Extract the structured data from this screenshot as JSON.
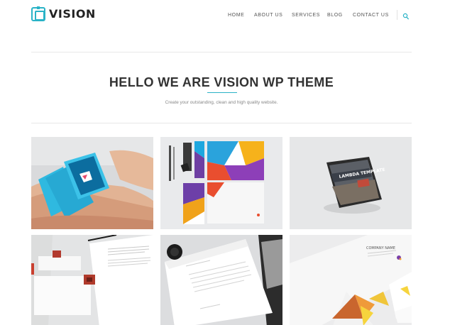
{
  "brand": {
    "name": "VISION",
    "accent": "#2ab3c7"
  },
  "nav": {
    "items": [
      {
        "label": "HOME"
      },
      {
        "label": "ABOUT US"
      },
      {
        "label": "SERVICES"
      },
      {
        "label": "BLOG"
      },
      {
        "label": "CONTACT US"
      }
    ],
    "search_icon": "search-icon"
  },
  "hero": {
    "title": "HELLO WE ARE VISION WP THEME",
    "subtitle": "Create your outstanding, clean and high quality website."
  },
  "portfolio": {
    "items": [
      {
        "subject": "smartwatch"
      },
      {
        "subject": "stationery-branding"
      },
      {
        "subject": "magazine",
        "cover_text": "LAMBDA TEMPLATE"
      },
      {
        "subject": "letterhead-red-stamp"
      },
      {
        "subject": "letterhead-black-seal"
      },
      {
        "subject": "business-card",
        "card_text": "COMPANY NAME"
      }
    ]
  }
}
